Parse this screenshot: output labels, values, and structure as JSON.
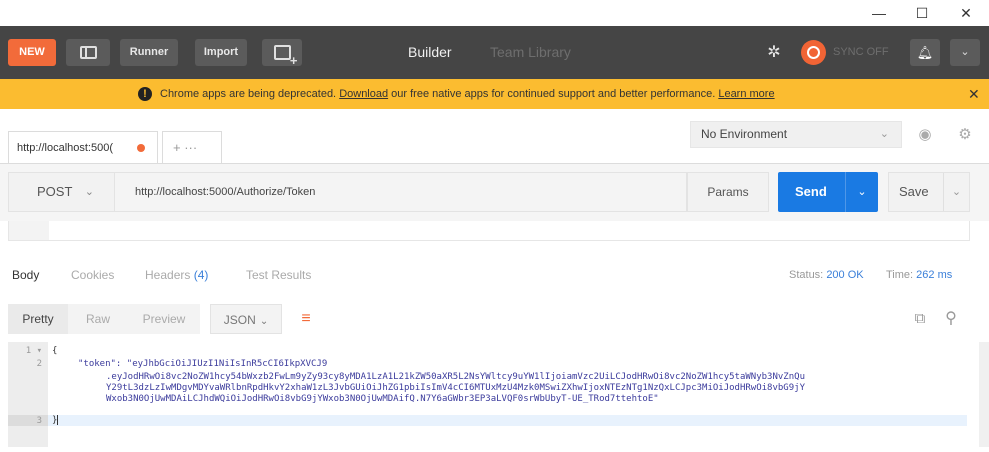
{
  "window": {
    "minimize": "—",
    "maximize": "☐",
    "close": "✕"
  },
  "header": {
    "new_label": "NEW",
    "runner_label": "Runner",
    "import_label": "Import",
    "tab_builder": "Builder",
    "tab_team_library": "Team Library",
    "sync_label": "SYNC OFF",
    "caret": "⌄"
  },
  "banner": {
    "text_before": "Chrome apps are being deprecated.",
    "download_link": "Download",
    "text_after": "our free native apps for continued support and better performance.",
    "learn_more_link": "Learn more",
    "close": "✕"
  },
  "tabs": {
    "request_tab": "http://localhost:500(",
    "add_tab": "+   ···",
    "environment": "No Environment"
  },
  "request": {
    "method": "POST",
    "url": "http://localhost:5000/Authorize/Token",
    "params_label": "Params",
    "send_label": "Send",
    "save_label": "Save"
  },
  "response": {
    "tab_body": "Body",
    "tab_cookies": "Cookies",
    "tab_headers": "Headers",
    "headers_count": "(4)",
    "tab_test_results": "Test Results",
    "status_label": "Status:",
    "status_value": "200 OK",
    "time_label": "Time:",
    "time_value": "262 ms"
  },
  "format": {
    "pretty": "Pretty",
    "raw": "Raw",
    "preview": "Preview",
    "json": "JSON"
  },
  "editor": {
    "line_numbers": [
      "1",
      "2",
      "3"
    ],
    "line1": "{",
    "line2_key": "\"token\": ",
    "line2_value": "\"eyJhbGciOiJIUzI1NiIsInR5cCI6IkpXVCJ9",
    "line2_cont1": ".eyJodHRwOi8vc2NoZW1hcy54bWxzb2FwLm9yZy93cy8yMDA1LzA1L21kZW50aXR5L2NsYWltcy9uYW1lIjoiamVzc2UiLCJodHRwOi8vc2NoZW1hcy5taWNyb3NvZnQu",
    "line2_cont2": "Y29tL3dzLzIwMDgvMDYvaWRlbnRpdHkvY2xhaW1zL3JvbGUiOiJhZG1pbiIsImV4cCI6MTUxMzU4Mzk0MSwiZXhwIjoxNTEzNTg1NzQxLCJpc3MiOiJodHRwOi8vbG9jY",
    "line2_cont3": "Wxob3N0OjUwMDAiLCJhdWQiOiJodHRwOi8vbG9jYWxob3N0OjUwMDAifQ.N7Y6aGWbr3EP3aLVQF0srWbUbyT-UE_TRod7ttehtoE\"",
    "line3": "}"
  }
}
